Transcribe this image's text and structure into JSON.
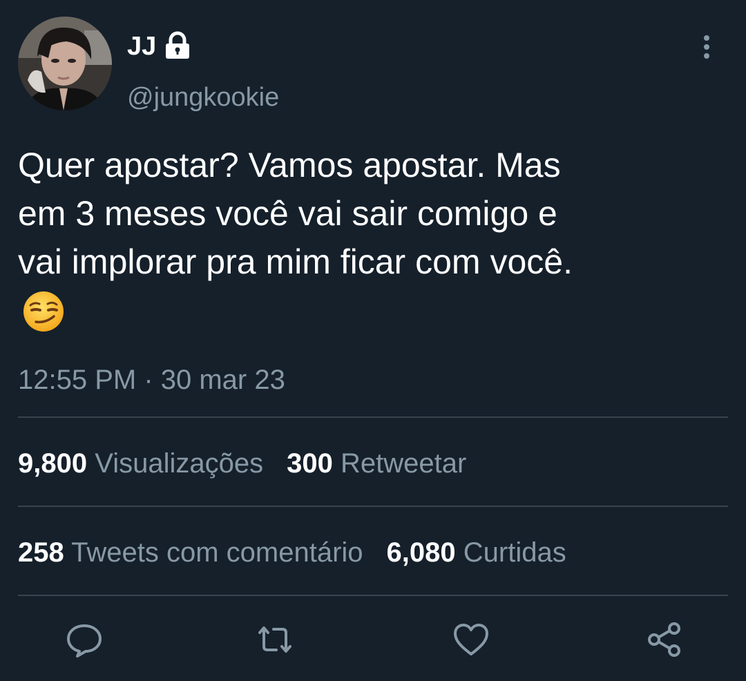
{
  "author": {
    "display_name": "JJ",
    "handle": "@jungkookie",
    "protected_badge": "lock-icon",
    "avatar": "profile-photo"
  },
  "tweet": {
    "text": "Quer apostar? Vamos apostar. Mas\nem 3 meses você vai sair comigo e\nvai implorar pra mim ficar com você.",
    "emoji": "smirking-face-emoji",
    "timestamp": "12:55 PM · 30 mar 23"
  },
  "stats": {
    "views_count": "9,800",
    "views_label": "Visualizações",
    "retweets_count": "300",
    "retweets_label": "Retweetar",
    "quotes_count": "258",
    "quotes_label": "Tweets com comentário",
    "likes_count": "6,080",
    "likes_label": "Curtidas"
  },
  "actions": [
    "reply-icon",
    "retweet-icon",
    "like-icon",
    "share-icon"
  ],
  "colors": {
    "background": "#15202b",
    "text_primary": "#ffffff",
    "text_secondary": "#8899a6",
    "divider": "#38444d"
  }
}
